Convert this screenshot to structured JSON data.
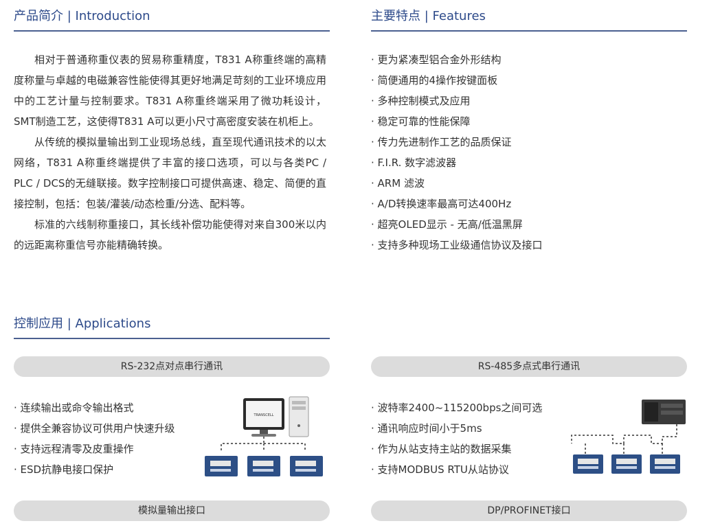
{
  "intro": {
    "heading": "产品简介 | Introduction",
    "paragraphs": [
      "相对于普通称重仪表的贸易称重精度，T831 A称重终端的高精度称量与卓越的电磁兼容性能使得其更好地满足苛刻的工业环境应用中的工艺计量与控制要求。T831 A称重终端采用了微功耗设计，SMT制造工艺，这使得T831 A可以更小尺寸高密度安装在机柜上。",
      "从传统的模拟量输出到工业现场总线，直至现代通讯技术的以太网络，T831 A称重终端提供了丰富的接口选项，可以与各类PC / PLC / DCS的无缝联接。数字控制接口可提供高速、稳定、简便的直接控制，包括：包装/灌装/动态检重/分选、配料等。",
      "标准的六线制称重接口，其长线补偿功能使得对来自300米以内的远距离称重信号亦能精确转换。"
    ]
  },
  "features": {
    "heading": "主要特点 | Features",
    "items": [
      "更为紧凑型铝合金外形结构",
      "简便通用的4操作按键面板",
      "多种控制模式及应用",
      "稳定可靠的性能保障",
      "传力先进制作工艺的品质保证",
      "F.I.R. 数字滤波器",
      "ARM 滤波",
      "A/D转换速率最高可达400Hz",
      "超亮OLED显示 - 无高/低温黑屏",
      "支持多种现场工业级通信协议及接口"
    ]
  },
  "applications": {
    "heading": "控制应用 | Applications",
    "rs232": {
      "label": "RS-232点对点串行通讯",
      "items": [
        "连续输出或命令输出格式",
        "提供全兼容协议可供用户快速升级",
        "支持远程清零及皮重操作",
        "ESD抗静电接口保护"
      ],
      "monitor_brand": "TRANSCELL"
    },
    "rs485": {
      "label": "RS-485多点式串行通讯",
      "items": [
        "波特率2400~115200bps之间可选",
        "通讯响应时间小于5ms",
        "作为从站支持主站的数据采集",
        "支持MODBUS  RTU从站协议"
      ]
    },
    "analog_label": "模拟量输出接口",
    "dp_label": "DP/PROFINET接口"
  },
  "colors": {
    "heading": "#2d4a8a",
    "rule": "#4a5f8f",
    "pill": "#dcdcdc",
    "device": "#2d4f86"
  }
}
